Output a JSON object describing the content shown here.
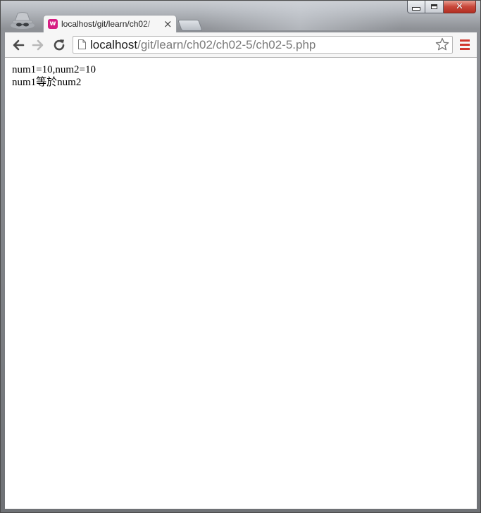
{
  "window": {
    "controls": {
      "minimize_icon": "minimize-icon",
      "maximize_icon": "maximize-icon",
      "close_icon": "close-icon",
      "close_glyph": "✕"
    },
    "incognito_icon": "incognito-icon"
  },
  "tabs": [
    {
      "title": "localhost/git/learn/ch02/",
      "favicon_letter": "w",
      "favicon_color": "#d61e83",
      "close_glyph": "×"
    }
  ],
  "toolbar": {
    "back_icon": "back-arrow-icon",
    "forward_icon": "forward-arrow-icon",
    "reload_icon": "reload-icon",
    "url_host": "localhost",
    "url_path": "/git/learn/ch02/ch02-5/ch02-5.php",
    "star_icon": "star-icon",
    "menu_icon": "hamburger-menu-icon",
    "menu_color": "#d1382e"
  },
  "page": {
    "lines": [
      "num1=10,num2=10",
      "num1等於num2"
    ]
  }
}
